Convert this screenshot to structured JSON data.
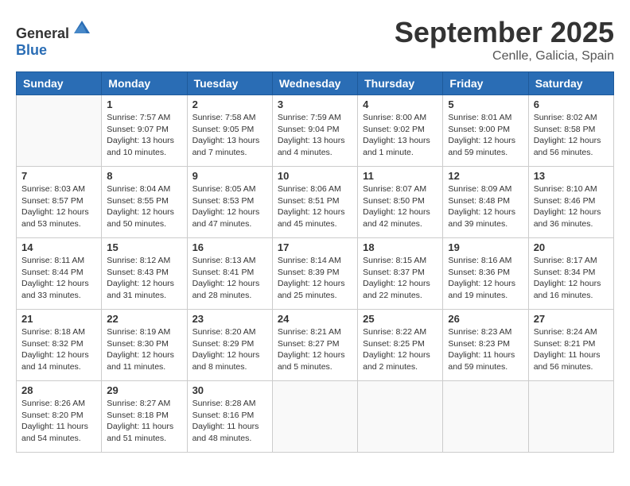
{
  "header": {
    "logo_general": "General",
    "logo_blue": "Blue",
    "month": "September 2025",
    "location": "Cenlle, Galicia, Spain"
  },
  "days_of_week": [
    "Sunday",
    "Monday",
    "Tuesday",
    "Wednesday",
    "Thursday",
    "Friday",
    "Saturday"
  ],
  "weeks": [
    [
      {
        "day": "",
        "info": ""
      },
      {
        "day": "1",
        "info": "Sunrise: 7:57 AM\nSunset: 9:07 PM\nDaylight: 13 hours\nand 10 minutes."
      },
      {
        "day": "2",
        "info": "Sunrise: 7:58 AM\nSunset: 9:05 PM\nDaylight: 13 hours\nand 7 minutes."
      },
      {
        "day": "3",
        "info": "Sunrise: 7:59 AM\nSunset: 9:04 PM\nDaylight: 13 hours\nand 4 minutes."
      },
      {
        "day": "4",
        "info": "Sunrise: 8:00 AM\nSunset: 9:02 PM\nDaylight: 13 hours\nand 1 minute."
      },
      {
        "day": "5",
        "info": "Sunrise: 8:01 AM\nSunset: 9:00 PM\nDaylight: 12 hours\nand 59 minutes."
      },
      {
        "day": "6",
        "info": "Sunrise: 8:02 AM\nSunset: 8:58 PM\nDaylight: 12 hours\nand 56 minutes."
      }
    ],
    [
      {
        "day": "7",
        "info": "Sunrise: 8:03 AM\nSunset: 8:57 PM\nDaylight: 12 hours\nand 53 minutes."
      },
      {
        "day": "8",
        "info": "Sunrise: 8:04 AM\nSunset: 8:55 PM\nDaylight: 12 hours\nand 50 minutes."
      },
      {
        "day": "9",
        "info": "Sunrise: 8:05 AM\nSunset: 8:53 PM\nDaylight: 12 hours\nand 47 minutes."
      },
      {
        "day": "10",
        "info": "Sunrise: 8:06 AM\nSunset: 8:51 PM\nDaylight: 12 hours\nand 45 minutes."
      },
      {
        "day": "11",
        "info": "Sunrise: 8:07 AM\nSunset: 8:50 PM\nDaylight: 12 hours\nand 42 minutes."
      },
      {
        "day": "12",
        "info": "Sunrise: 8:09 AM\nSunset: 8:48 PM\nDaylight: 12 hours\nand 39 minutes."
      },
      {
        "day": "13",
        "info": "Sunrise: 8:10 AM\nSunset: 8:46 PM\nDaylight: 12 hours\nand 36 minutes."
      }
    ],
    [
      {
        "day": "14",
        "info": "Sunrise: 8:11 AM\nSunset: 8:44 PM\nDaylight: 12 hours\nand 33 minutes."
      },
      {
        "day": "15",
        "info": "Sunrise: 8:12 AM\nSunset: 8:43 PM\nDaylight: 12 hours\nand 31 minutes."
      },
      {
        "day": "16",
        "info": "Sunrise: 8:13 AM\nSunset: 8:41 PM\nDaylight: 12 hours\nand 28 minutes."
      },
      {
        "day": "17",
        "info": "Sunrise: 8:14 AM\nSunset: 8:39 PM\nDaylight: 12 hours\nand 25 minutes."
      },
      {
        "day": "18",
        "info": "Sunrise: 8:15 AM\nSunset: 8:37 PM\nDaylight: 12 hours\nand 22 minutes."
      },
      {
        "day": "19",
        "info": "Sunrise: 8:16 AM\nSunset: 8:36 PM\nDaylight: 12 hours\nand 19 minutes."
      },
      {
        "day": "20",
        "info": "Sunrise: 8:17 AM\nSunset: 8:34 PM\nDaylight: 12 hours\nand 16 minutes."
      }
    ],
    [
      {
        "day": "21",
        "info": "Sunrise: 8:18 AM\nSunset: 8:32 PM\nDaylight: 12 hours\nand 14 minutes."
      },
      {
        "day": "22",
        "info": "Sunrise: 8:19 AM\nSunset: 8:30 PM\nDaylight: 12 hours\nand 11 minutes."
      },
      {
        "day": "23",
        "info": "Sunrise: 8:20 AM\nSunset: 8:29 PM\nDaylight: 12 hours\nand 8 minutes."
      },
      {
        "day": "24",
        "info": "Sunrise: 8:21 AM\nSunset: 8:27 PM\nDaylight: 12 hours\nand 5 minutes."
      },
      {
        "day": "25",
        "info": "Sunrise: 8:22 AM\nSunset: 8:25 PM\nDaylight: 12 hours\nand 2 minutes."
      },
      {
        "day": "26",
        "info": "Sunrise: 8:23 AM\nSunset: 8:23 PM\nDaylight: 11 hours\nand 59 minutes."
      },
      {
        "day": "27",
        "info": "Sunrise: 8:24 AM\nSunset: 8:21 PM\nDaylight: 11 hours\nand 56 minutes."
      }
    ],
    [
      {
        "day": "28",
        "info": "Sunrise: 8:26 AM\nSunset: 8:20 PM\nDaylight: 11 hours\nand 54 minutes."
      },
      {
        "day": "29",
        "info": "Sunrise: 8:27 AM\nSunset: 8:18 PM\nDaylight: 11 hours\nand 51 minutes."
      },
      {
        "day": "30",
        "info": "Sunrise: 8:28 AM\nSunset: 8:16 PM\nDaylight: 11 hours\nand 48 minutes."
      },
      {
        "day": "",
        "info": ""
      },
      {
        "day": "",
        "info": ""
      },
      {
        "day": "",
        "info": ""
      },
      {
        "day": "",
        "info": ""
      }
    ]
  ]
}
